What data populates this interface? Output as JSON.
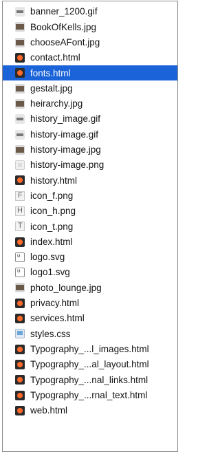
{
  "files": [
    {
      "name": "banner_1200.gif",
      "icon": "gif-file-icon",
      "iconClass": "gif",
      "selected": false
    },
    {
      "name": "BookOfKells.jpg",
      "icon": "jpg-file-icon",
      "iconClass": "jpg",
      "selected": false
    },
    {
      "name": "chooseAFont.jpg",
      "icon": "jpg-file-icon",
      "iconClass": "jpg",
      "selected": false
    },
    {
      "name": "contact.html",
      "icon": "html-file-icon",
      "iconClass": "html",
      "selected": false
    },
    {
      "name": "fonts.html",
      "icon": "html-file-icon",
      "iconClass": "html",
      "selected": true
    },
    {
      "name": "gestalt.jpg",
      "icon": "jpg-file-icon",
      "iconClass": "jpg",
      "selected": false
    },
    {
      "name": "heirarchy.jpg",
      "icon": "jpg-file-icon",
      "iconClass": "jpg",
      "selected": false
    },
    {
      "name": "history_image.gif",
      "icon": "gif-file-icon",
      "iconClass": "gif",
      "selected": false
    },
    {
      "name": "history-image.gif",
      "icon": "gif-file-icon",
      "iconClass": "gif",
      "selected": false
    },
    {
      "name": "history-image.jpg",
      "icon": "jpg-file-icon",
      "iconClass": "jpg",
      "selected": false
    },
    {
      "name": "history-image.png",
      "icon": "png-file-icon",
      "iconClass": "png",
      "selected": false
    },
    {
      "name": "history.html",
      "icon": "html-file-icon",
      "iconClass": "html",
      "selected": false
    },
    {
      "name": "icon_f.png",
      "icon": "png-file-icon",
      "iconClass": "thumb-f",
      "selected": false
    },
    {
      "name": "icon_h.png",
      "icon": "png-file-icon",
      "iconClass": "thumb-h",
      "selected": false
    },
    {
      "name": "icon_t.png",
      "icon": "png-file-icon",
      "iconClass": "thumb-t",
      "selected": false
    },
    {
      "name": "index.html",
      "icon": "html-file-icon",
      "iconClass": "html",
      "selected": false
    },
    {
      "name": "logo.svg",
      "icon": "svg-file-icon",
      "iconClass": "svg",
      "selected": false
    },
    {
      "name": "logo1.svg",
      "icon": "svg-file-icon",
      "iconClass": "svg",
      "selected": false
    },
    {
      "name": "photo_lounge.jpg",
      "icon": "jpg-file-icon",
      "iconClass": "jpg",
      "selected": false
    },
    {
      "name": "privacy.html",
      "icon": "html-file-icon",
      "iconClass": "html",
      "selected": false
    },
    {
      "name": "services.html",
      "icon": "html-file-icon",
      "iconClass": "html",
      "selected": false
    },
    {
      "name": "styles.css",
      "icon": "css-file-icon",
      "iconClass": "css",
      "selected": false
    },
    {
      "name": "Typography_...l_images.html",
      "icon": "html-file-icon",
      "iconClass": "html",
      "selected": false
    },
    {
      "name": "Typography_...al_layout.html",
      "icon": "html-file-icon",
      "iconClass": "html",
      "selected": false
    },
    {
      "name": "Typography_...nal_links.html",
      "icon": "html-file-icon",
      "iconClass": "html",
      "selected": false
    },
    {
      "name": "Typography_...rnal_text.html",
      "icon": "html-file-icon",
      "iconClass": "html",
      "selected": false
    },
    {
      "name": "web.html",
      "icon": "html-file-icon",
      "iconClass": "html",
      "selected": false
    }
  ],
  "colors": {
    "selection": "#1a63d8",
    "border": "#8a8a8a",
    "background": "#ffffff"
  }
}
